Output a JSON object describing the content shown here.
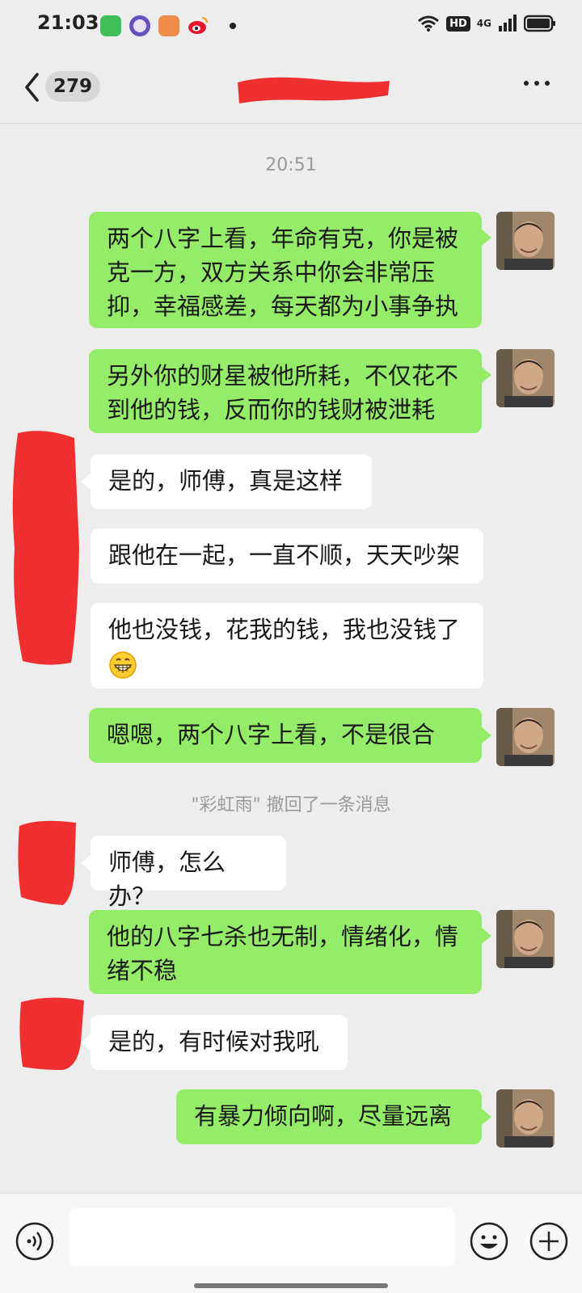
{
  "status_bar": {
    "time": "21:03",
    "hd_label": "HD",
    "network_label": "4G",
    "app_icons": [
      "app-green-icon",
      "app-purple-icon",
      "app-orange-book-icon",
      "weibo-icon"
    ]
  },
  "nav": {
    "unread_count": "279",
    "title_redacted": true
  },
  "timestamp": "20:51",
  "recall_notice": "\"彩虹雨\" 撤回了一条消息",
  "messages": {
    "m1": {
      "line1": "两个八字上看，年命有克，你是被",
      "line2": "克一方，双方关系中你会非常压",
      "line3": "抑，幸福感差，每天都为小事争执"
    },
    "m2": {
      "line1": "另外你的财星被他所耗，不仅花不",
      "line2": "到他的钱，反而你的钱财被泄耗"
    },
    "m3": {
      "text": "是的，师傅，真是这样"
    },
    "m4": {
      "text": "跟他在一起，一直不顺，天天吵架"
    },
    "m5": {
      "text": "他也没钱，花我的钱，我也没钱了",
      "emoji": "grinning-face-emoji"
    },
    "m6": {
      "text": "嗯嗯，两个八字上看，不是很合"
    },
    "m7": {
      "text": "师傅，怎么办？"
    },
    "m8": {
      "line1": "他的八字七杀也无制，情绪化，情",
      "line2": "绪不稳"
    },
    "m9": {
      "text": "是的，有时候对我吼"
    },
    "m10": {
      "text": "有暴力倾向啊，尽量远离"
    }
  },
  "colors": {
    "outgoing_bubble": "#95ec69",
    "incoming_bubble": "#ffffff",
    "background": "#ededed",
    "redaction": "#f03030"
  }
}
